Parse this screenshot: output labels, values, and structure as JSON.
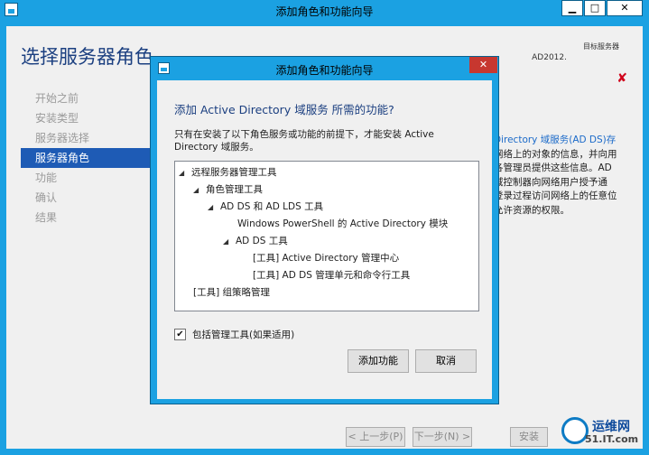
{
  "outer": {
    "title": "添加角色和功能向导",
    "btn_min": "▁",
    "btn_max": "□",
    "btn_close": "✕",
    "page_title": "选择服务器角色",
    "dest_label": "目标服务器",
    "dest_value": "AD2012.",
    "steps": [
      "开始之前",
      "安装类型",
      "服务器选择",
      "服务器角色",
      "功能",
      "确认",
      "结果"
    ],
    "active_step_index": 3,
    "description_lines": [
      "Directory 域服务(AD DS)存",
      "网络上的对象的信息，并向用",
      "各管理员提供这些信息。AD",
      "域控制器向网络用户授予通",
      "登录过程访问网络上的任意位",
      "允许资源的权限。"
    ],
    "btn_prev": "< 上一步(P)",
    "btn_next": "下一步(N) >",
    "btn_install": "安装",
    "watermark_main": "运维网",
    "watermark_sub": "51.IT.com"
  },
  "dialog": {
    "title": "添加角色和功能向导",
    "close_label": "✕",
    "heading": "添加 Active Directory 域服务 所需的功能?",
    "description": "只有在安装了以下角色服务或功能的前提下，才能安装 Active Directory 域服务。",
    "tree": [
      {
        "label": "远程服务器管理工具",
        "expander": "◢"
      },
      {
        "label": "角色管理工具",
        "expander": "◢"
      },
      {
        "label": "AD DS 和 AD LDS 工具",
        "expander": "◢"
      },
      {
        "label": "Windows PowerShell 的 Active Directory 模块",
        "expander": ""
      },
      {
        "label": "AD DS 工具",
        "expander": "◢"
      },
      {
        "label": "[工具] Active Directory 管理中心",
        "expander": ""
      },
      {
        "label": "[工具] AD DS 管理单元和命令行工具",
        "expander": ""
      },
      {
        "label": "[工具] 组策略管理",
        "expander": ""
      }
    ],
    "checkbox_checked": true,
    "checkbox_mark": "✔",
    "checkbox_label": "包括管理工具(如果适用)",
    "btn_add": "添加功能",
    "btn_cancel": "取消"
  },
  "colors": {
    "window_chrome": "#1ba1e2",
    "heading_blue": "#1b3f80",
    "active_step": "#1e5bb5",
    "close_red": "#c7372f"
  },
  "icons": {
    "app_icon": "server-manager-icon",
    "error_icon": "red-x-icon",
    "tree_expander": "triangle-expander-icon"
  }
}
